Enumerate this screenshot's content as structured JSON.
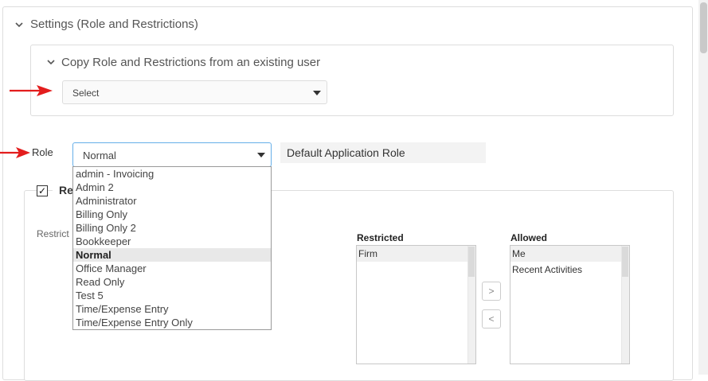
{
  "settings": {
    "title": "Settings (Role and Restrictions)"
  },
  "copy_role": {
    "title": "Copy Role and Restrictions from an existing user",
    "select_value": "Select"
  },
  "role": {
    "label": "Role",
    "selected": "Normal",
    "default_label": "Default Application Role",
    "options": [
      "admin - Invoicing",
      "Admin 2",
      "Administrator",
      "Billing Only",
      "Billing Only 2",
      "Bookkeeper",
      "Normal",
      "Office Manager",
      "Read Only",
      "Test 5",
      "Time/Expense Entry",
      "Time/Expense Entry Only"
    ]
  },
  "restrictions": {
    "checkbox_label_visible": "Re",
    "checkbox_mark": "✓",
    "field_label_visible": "Restrict",
    "restricted_title": "Restricted",
    "restricted_items": [
      "Firm"
    ],
    "allowed_title": "Allowed",
    "allowed_items": [
      "Me",
      "Recent Activities"
    ],
    "move_right_label": ">",
    "move_left_label": "<"
  },
  "colors": {
    "arrow": "#e31d1d",
    "focus_border": "#66afe9",
    "selected_option_bg": "#e8e8e8"
  }
}
